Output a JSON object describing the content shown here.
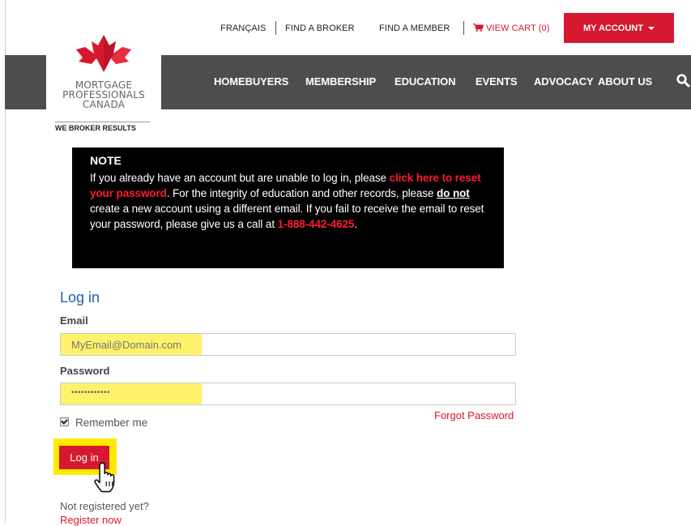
{
  "utility_nav": {
    "francais": "FRANÇAIS",
    "find_broker": "FIND A BROKER",
    "find_member": "FIND A MEMBER",
    "view_cart": "VIEW CART (0)",
    "my_account": "MY ACCOUNT"
  },
  "logo": {
    "line1": "MORTGAGE",
    "line2": "PROFESSIONALS",
    "line3": "CANADA",
    "tagline": "WE BROKER RESULTS"
  },
  "main_nav": [
    "HOMEBUYERS",
    "MEMBERSHIP",
    "EDUCATION",
    "EVENTS",
    "ADVOCACY",
    "ABOUT US"
  ],
  "note": {
    "title": "NOTE",
    "p1": "If you already have an account but are unable to log in, please ",
    "reset_link": "click here to reset your password",
    "p2": ". For the integrity of education and other records, please ",
    "emph": "do not",
    "p3": " create a new account using a different email. If you fail to receive the email to reset your password, please give us a call at ",
    "phone": "1-888-442-4625",
    "p4": "."
  },
  "login": {
    "heading": "Log in",
    "email_label": "Email",
    "email_value": "MyEmail@Domain.com",
    "password_label": "Password",
    "password_value": "••••••••••••",
    "remember_label": "Remember me",
    "forgot_label": "Forgot Password",
    "submit_label": "Log in",
    "not_registered": "Not registered yet?",
    "register_link": "Register now"
  },
  "colors": {
    "brand_red": "#d7192f",
    "nav_bg": "#4d4d4d",
    "highlight": "#fff26b",
    "link_blue": "#1e5fa8"
  },
  "icons": [
    "cart-icon",
    "caret-down-icon",
    "search-icon",
    "maple-leaf-icon",
    "checkbox-icon",
    "hand-pointer-icon"
  ]
}
